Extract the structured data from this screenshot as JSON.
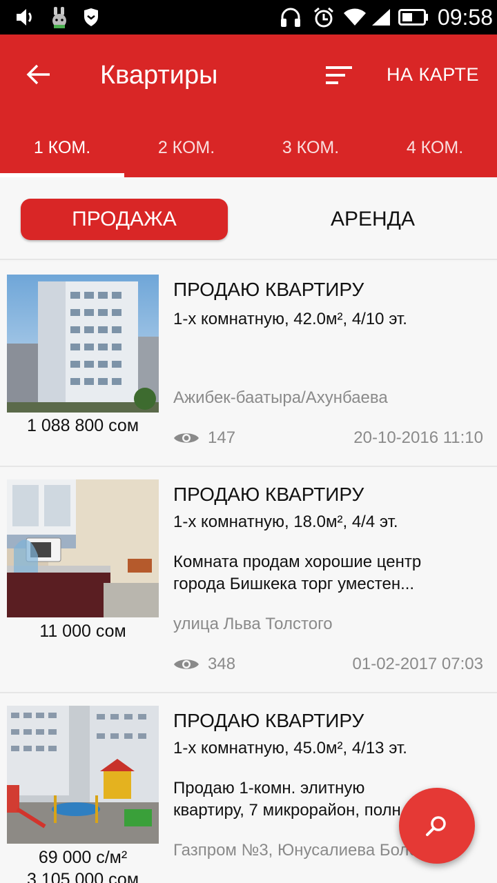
{
  "status_bar": {
    "time": "09:58",
    "icons": [
      "volume-icon",
      "rabbit-app-icon",
      "shield-icon",
      "headset-icon",
      "alarm-icon",
      "wifi-icon",
      "signal-icon",
      "battery-icon"
    ]
  },
  "app_bar": {
    "title": "Квартиры",
    "map_label": "НА КАРТЕ",
    "background_color": "#d92626"
  },
  "tabs": [
    {
      "label": "1 КОМ.",
      "active": true
    },
    {
      "label": "2 КОМ.",
      "active": false
    },
    {
      "label": "3 КОМ.",
      "active": false
    },
    {
      "label": "4 КОМ.",
      "active": false
    }
  ],
  "segment": {
    "sale_label": "ПРОДАЖА",
    "rent_label": "АРЕНДА",
    "selected": "sale"
  },
  "listings": [
    {
      "title": "ПРОДАЮ КВАРТИРУ",
      "subtitle": "1-х комнатную, 42.0м², 4/10 эт.",
      "description": [],
      "address": "Ажибек-баатыра/Ахунбаева",
      "views": "147",
      "date": "20-10-2016 11:10",
      "price": [
        "1 088 800 сом"
      ],
      "image": "building-photo"
    },
    {
      "title": "ПРОДАЮ КВАРТИРУ",
      "subtitle": "1-х комнатную, 18.0м², 4/4 эт.",
      "description": [
        "Комната продам хорошие центр",
        "города Бишкека торг уместен..."
      ],
      "address": "улица Льва Толстого",
      "views": "348",
      "date": "01-02-2017 07:03",
      "price": [
        "11 000 сом"
      ],
      "image": "kitchen-photo"
    },
    {
      "title": "ПРОДАЮ КВАРТИРУ",
      "subtitle": "1-х комнатную, 45.0м², 4/13 эт.",
      "description": [
        "Продаю 1-комн. элитную",
        "квартиру, 7 микрорайон, полн..."
      ],
      "address": "Газпром №3,  Юнусалиева Боло...",
      "views": "",
      "date": "",
      "price": [
        "69 000 с/м²",
        "3 105 000 сом"
      ],
      "image": "playground-photo"
    }
  ],
  "fab": {
    "icon": "search-icon",
    "color": "#e53935"
  }
}
